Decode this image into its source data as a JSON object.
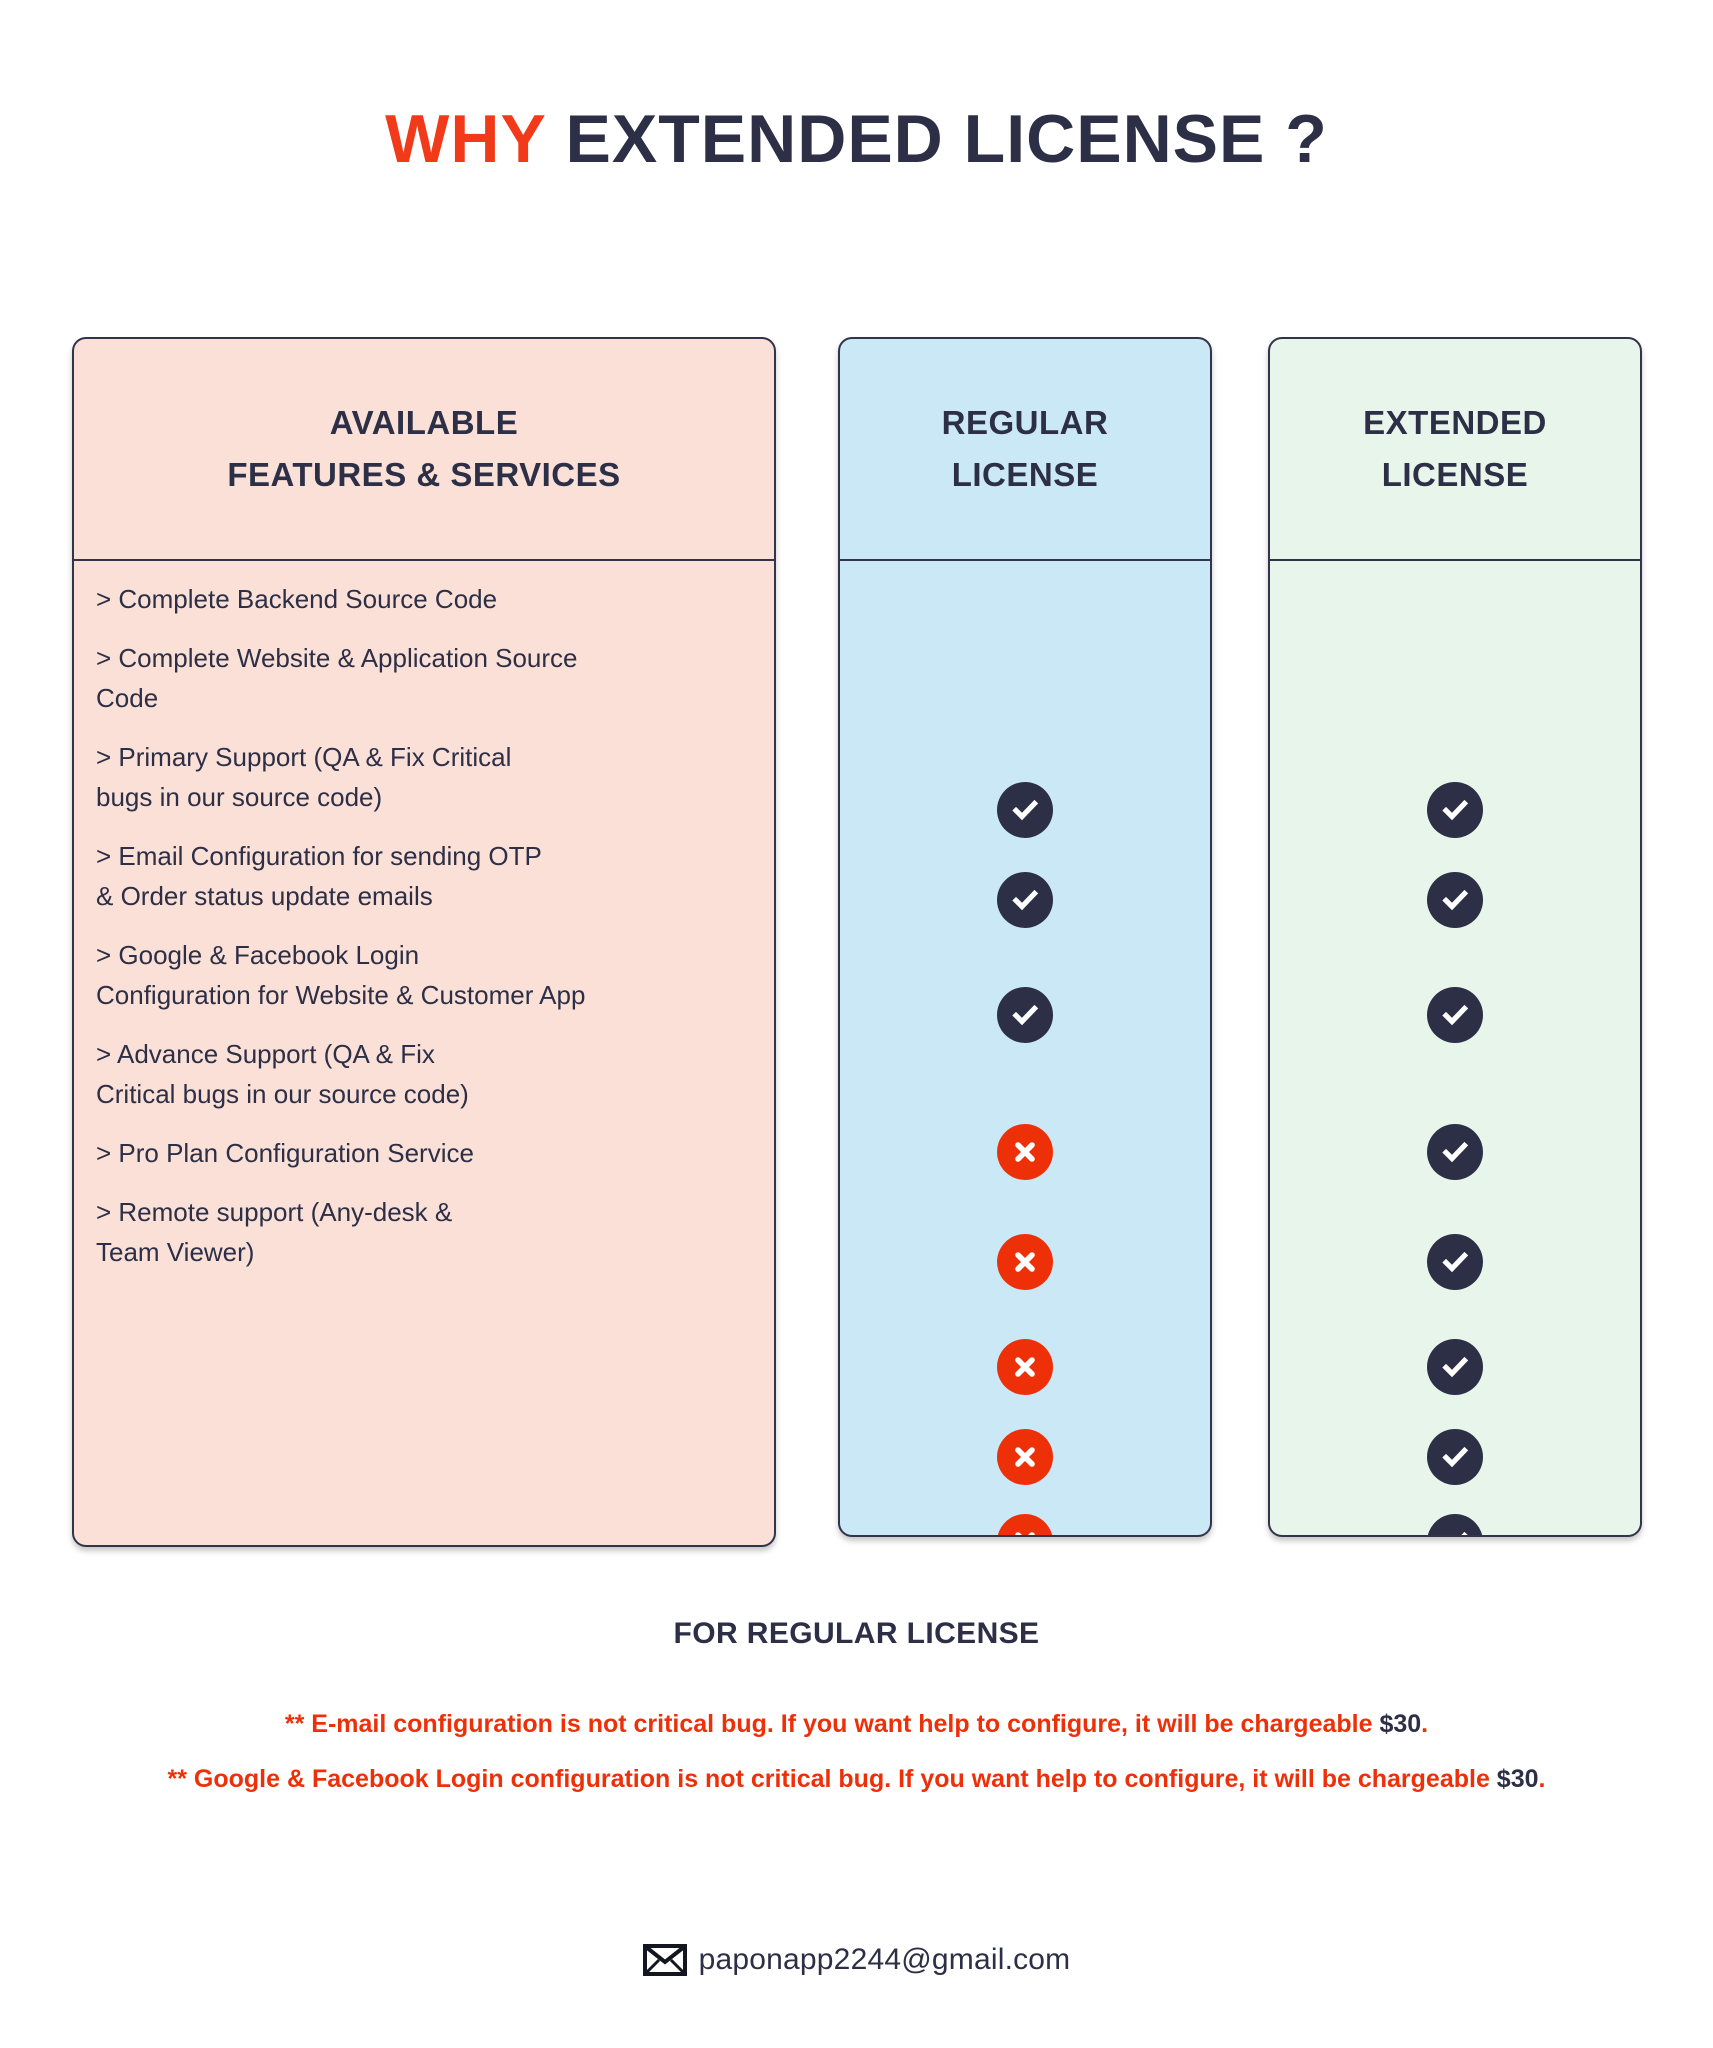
{
  "title": {
    "accent_word": "WHY",
    "rest": "EXTENDED LICENSE ?"
  },
  "colors": {
    "accent_red": "#f13a1a",
    "dark_navy": "#2c2f45",
    "features_bg": "#fbe0d8",
    "regular_bg": "#cbe8f7",
    "extended_bg": "#e8f5ea",
    "cross_red": "#ee3009"
  },
  "columns": {
    "features": {
      "head_line1": "AVAILABLE",
      "head_line2": "FEATURES & SERVICES"
    },
    "regular": {
      "head_line1": "REGULAR",
      "head_line2": "LICENSE"
    },
    "extended": {
      "head_line1": "EXTENDED",
      "head_line2": "LICENSE"
    }
  },
  "features": [
    "> Complete Backend Source Code",
    "> Complete Website & Application Source\n Code",
    "> Primary Support (QA & Fix Critical\nbugs in our source code)",
    "> Email Configuration for sending OTP\n& Order status update emails",
    "> Google & Facebook Login\nConfiguration for Website & Customer App",
    "> Advance Support (QA & Fix\nCritical bugs in our source code)",
    "> Pro Plan Configuration Service",
    "> Remote support (Any-desk &\n  Team Viewer)"
  ],
  "marks": {
    "regular": [
      "yes",
      "yes",
      "yes",
      "no",
      "no",
      "no",
      "no",
      "no"
    ],
    "extended": [
      "yes",
      "yes",
      "yes",
      "yes",
      "yes",
      "yes",
      "yes",
      "yes"
    ],
    "positions": [
      473,
      563,
      678,
      815,
      925,
      1030,
      1120,
      1205
    ],
    "icon_names": {
      "yes": "check-icon",
      "no": "cross-icon"
    }
  },
  "footer": {
    "for_regular_label": "FOR REGULAR LICENSE",
    "notes": [
      {
        "text": "** E-mail configuration is not critical bug. If you want help to configure, it will be chargeable ",
        "amount": "$30",
        "tail": "."
      },
      {
        "text": "** Google & Facebook Login configuration is not critical bug. If you want help to configure, it will be chargeable ",
        "amount": "$30",
        "tail": "."
      }
    ],
    "email": "paponapp2244@gmail.com",
    "email_icon": "envelope-icon"
  }
}
